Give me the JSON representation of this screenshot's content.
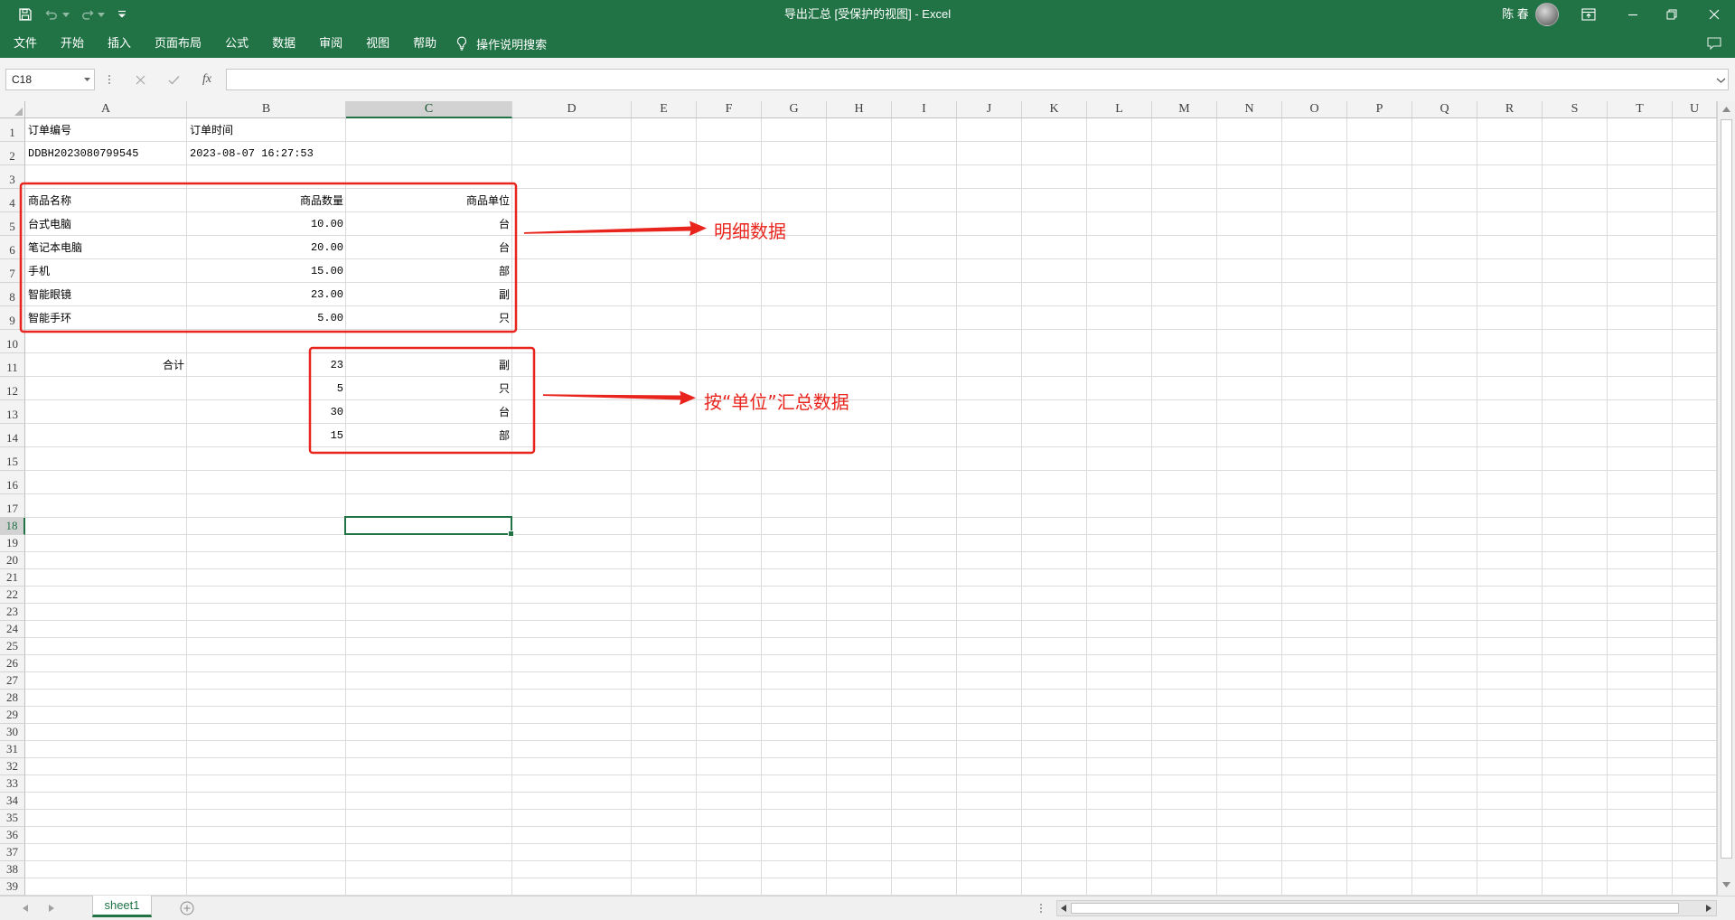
{
  "window": {
    "title": "导出汇总 [受保护的视图] - Excel",
    "user_name": "陈 春"
  },
  "ribbon": {
    "tabs": [
      "文件",
      "开始",
      "插入",
      "页面布局",
      "公式",
      "数据",
      "审阅",
      "视图",
      "帮助"
    ],
    "tell_me": "操作说明搜索"
  },
  "formula_bar": {
    "name_box": "C18",
    "fx_label": "fx",
    "formula": ""
  },
  "sheet": {
    "columns": [
      "A",
      "B",
      "C",
      "D",
      "E",
      "F",
      "G",
      "H",
      "I",
      "J",
      "K",
      "L",
      "M",
      "N",
      "O",
      "P",
      "Q",
      "R",
      "S",
      "T",
      "U"
    ],
    "rows": [
      1,
      2,
      3,
      4,
      5,
      6,
      7,
      8,
      9,
      10,
      11,
      12,
      13,
      14,
      15,
      16,
      17,
      18,
      19,
      20,
      21,
      22,
      23,
      24,
      25,
      26,
      27,
      28,
      29,
      30,
      31,
      32,
      33,
      34,
      35,
      36,
      37,
      38,
      39
    ],
    "cells": {
      "A1": "订单编号",
      "B1": "订单时间",
      "A2": "DDBH2023080799545",
      "B2": "2023-08-07 16:27:53",
      "A4": "商品名称",
      "B4": "商品数量",
      "C4": "商品单位",
      "A5": "台式电脑",
      "B5": "10.00",
      "C5": "台",
      "A6": "笔记本电脑",
      "B6": "20.00",
      "C6": "台",
      "A7": "手机",
      "B7": "15.00",
      "C7": "部",
      "A8": "智能眼镜",
      "B8": "23.00",
      "C8": "副",
      "A9": "智能手环",
      "B9": "5.00",
      "C9": "只",
      "A11": "合计",
      "B11": "23",
      "C11": "副",
      "B12": "5",
      "C12": "只",
      "B13": "30",
      "C13": "台",
      "B14": "15",
      "C14": "部"
    }
  },
  "sheets": [
    "sheet1"
  ],
  "annotations": {
    "detail_label": "明细数据",
    "summary_label": "按“单位”汇总数据"
  },
  "theme": {
    "accent": "#217346",
    "annotation": "#e8241d"
  }
}
